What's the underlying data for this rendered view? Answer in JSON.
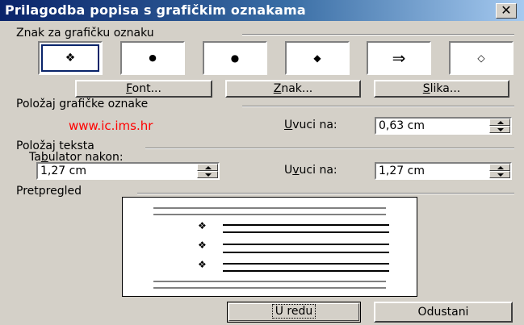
{
  "window": {
    "title": "Prilagodba popisa s grafičkim oznakama",
    "close_glyph": "✕"
  },
  "bullet_char": {
    "group_label": "Znak za grafičku oznaku",
    "options": [
      {
        "glyph": "❖",
        "icon": "four-diamond-icon",
        "selected": true
      },
      {
        "glyph": "●",
        "icon": "small-dot-icon",
        "selected": false
      },
      {
        "glyph": "●",
        "icon": "dot-icon",
        "selected": false
      },
      {
        "glyph": "◆",
        "icon": "diamond-icon",
        "selected": false
      },
      {
        "glyph": "⇒",
        "icon": "arrow-right-icon",
        "selected": false
      },
      {
        "glyph": "◇",
        "icon": "outline-diamond-icon",
        "selected": false
      }
    ],
    "buttons": {
      "font": {
        "u": "F",
        "rest": "ont..."
      },
      "char": {
        "u": "Z",
        "rest": "nak..."
      },
      "picture": {
        "u": "S",
        "rest": "lika..."
      }
    }
  },
  "bullet_position": {
    "group_label": "Položaj grafičke oznake",
    "watermark": "www.ic.ims.hr",
    "indent_label_pre": "",
    "indent_label_u": "U",
    "indent_label_rest": "vuci na:",
    "indent_value": "0,63 cm"
  },
  "text_position": {
    "group_label": "Položaj teksta",
    "tab_label_pre": "Ta",
    "tab_label_u": "b",
    "tab_label_rest": "ulator nakon:",
    "tab_value": "1,27 cm",
    "indent_label_pre": "U",
    "indent_label_u": "v",
    "indent_label_rest": "uci na:",
    "indent_value": "1,27 cm"
  },
  "preview": {
    "group_label": "Pretpregled",
    "bullet_glyph": "❖"
  },
  "footer": {
    "ok_label": "U redu",
    "cancel_label": "Odustani"
  }
}
